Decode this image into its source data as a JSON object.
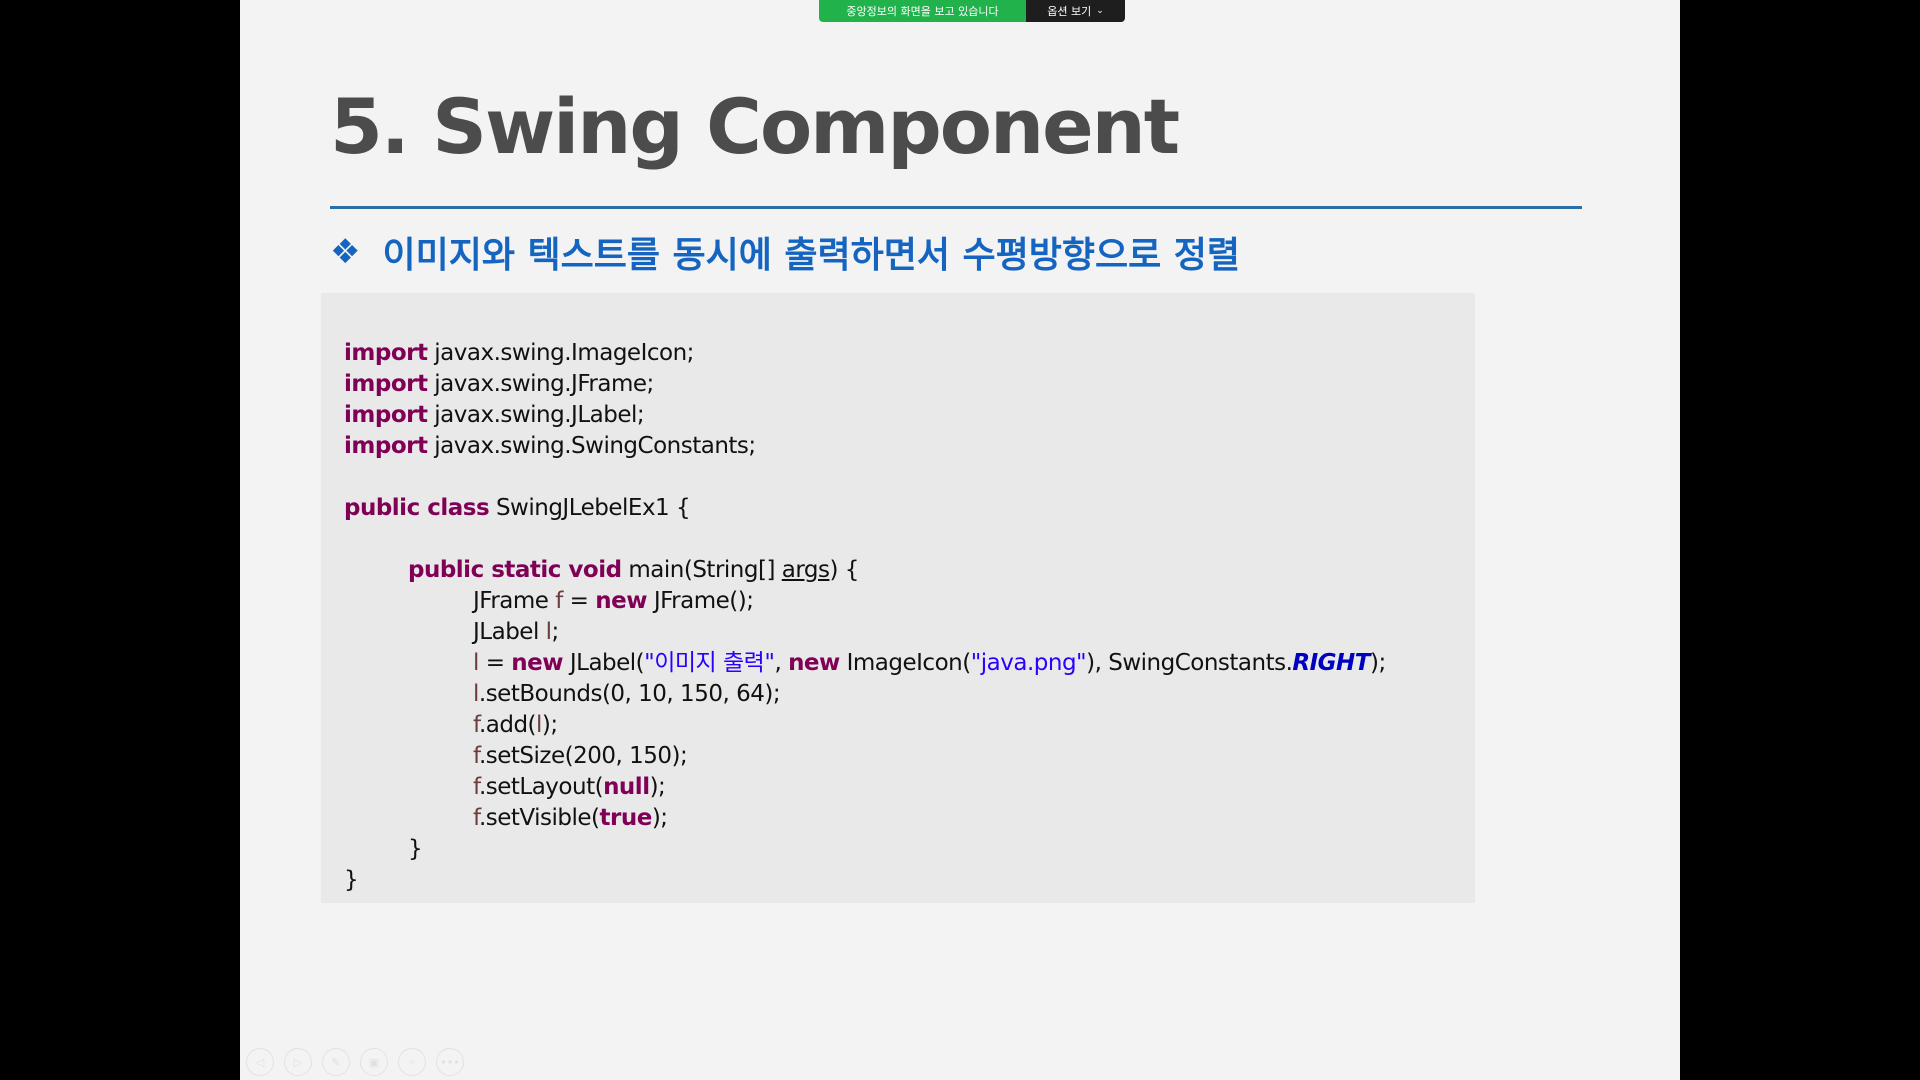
{
  "share_bar": {
    "status": "중앙정보의 화면을 보고 있습니다",
    "options_label": "옵션 보기"
  },
  "slide": {
    "title": "5. Swing Component",
    "subtitle_bullet": "❖",
    "subtitle": "이미지와 텍스트를 동시에 출력하면서 수평방향으로 정렬"
  },
  "code": {
    "import_kw": "import",
    "imports": [
      "javax.swing.ImageIcon;",
      "javax.swing.JFrame;",
      "javax.swing.JLabel;",
      "javax.swing.SwingConstants;"
    ],
    "class_kw": "public class",
    "class_name": "SwingJLebelEx1 {",
    "main_kw": "public static void",
    "main_sig_pre": "main(String[] ",
    "main_arg": "args",
    "main_sig_post": ") {",
    "l_frame": {
      "type": "JFrame ",
      "var": "f",
      "eq": " = ",
      "kw": "new",
      "rest": " JFrame();"
    },
    "l_label": {
      "type": "JLabel ",
      "var": "l",
      "end": ";"
    },
    "l_new": {
      "var": "l",
      "eq": " = ",
      "kw1": "new",
      "mid1": " JLabel(",
      "str1": "\"이미지 출력\"",
      "comma": ", ",
      "kw2": "new",
      "mid2": " ImageIcon(",
      "str2": "\"java.png\"",
      "mid3": "), SwingConstants.",
      "const": "RIGHT",
      "end": ");"
    },
    "l_bounds": {
      "var": "l",
      "rest": ".setBounds(0, 10, 150, 64);"
    },
    "l_add": {
      "var": "f",
      "pre": ".add(",
      "arg": "l",
      "end": ");"
    },
    "l_size": {
      "var": "f",
      "rest": ".setSize(200, 150);"
    },
    "l_layout": {
      "var": "f",
      "pre": ".setLayout(",
      "kw": "null",
      "end": ");"
    },
    "l_visible": {
      "var": "f",
      "pre": ".setVisible(",
      "kw": "true",
      "end": ");"
    },
    "close_inner": "}",
    "close_outer": "}"
  },
  "controls": {
    "icons": [
      "prev-icon",
      "next-icon",
      "pen-icon",
      "slides-icon",
      "zoom-icon",
      "more-icon"
    ],
    "glyphs": [
      "◁",
      "▷",
      "✎",
      "▣",
      "⌕",
      "•••"
    ]
  }
}
